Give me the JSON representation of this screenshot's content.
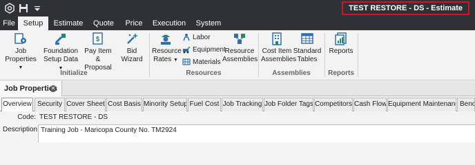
{
  "window": {
    "title": "TEST RESTORE - DS - Estimate",
    "quick_access": [
      "app-logo-icon",
      "save-icon",
      "dropdown-caret-icon"
    ]
  },
  "menu_tabs": [
    "File",
    "Setup",
    "Estimate",
    "Quote",
    "Price",
    "Execution",
    "System"
  ],
  "active_menu_tab": "Setup",
  "ribbon": {
    "groups": {
      "initialize": "Initialize",
      "resources": "Resources",
      "assemblies": "Assemblies",
      "reports": "Reports"
    },
    "buttons": {
      "job_properties": "Job Properties",
      "foundation_setup_data_1": "Foundation",
      "foundation_setup_data_2": "Setup Data",
      "pay_item_proposal_1": "Pay Item &",
      "pay_item_proposal_2": "Proposal",
      "bid_wizard": "Bid Wizard",
      "resource_rates_1": "Resource",
      "resource_rates_2": "Rates",
      "labor": "Labor",
      "equipment": "Equipment",
      "materials": "Materials",
      "resource_assemblies_1": "Resource",
      "resource_assemblies_2": "Assemblies",
      "cost_item_assemblies_1": "Cost Item",
      "cost_item_assemblies_2": "Assemblies",
      "standard_tables_1": "Standard",
      "standard_tables_2": "Tables",
      "reports": "Reports"
    }
  },
  "document_tab": {
    "label": "Job Properties"
  },
  "section_tabs": [
    "Overview",
    "Security",
    "Cover Sheet",
    "Cost Basis",
    "Minority Setup",
    "Fuel Cost",
    "Job Tracking",
    "Job Folder Tags",
    "Competitors",
    "Cash Flow",
    "Equipment Maintenance",
    "Bench"
  ],
  "active_section_tab": "Overview",
  "form": {
    "code_label": "Code:",
    "code_value": "TEST RESTORE - DS",
    "description_label": "Description:",
    "description_value": "Training Job - Maricopa County No. TM2924"
  },
  "colors": {
    "titlebar_bg": "#2f3136",
    "highlight_border": "#d0171f",
    "icon_blue": "#2d6fb5",
    "icon_teal": "#1f8a70",
    "ribbon_bg": "#f3f3f3"
  }
}
